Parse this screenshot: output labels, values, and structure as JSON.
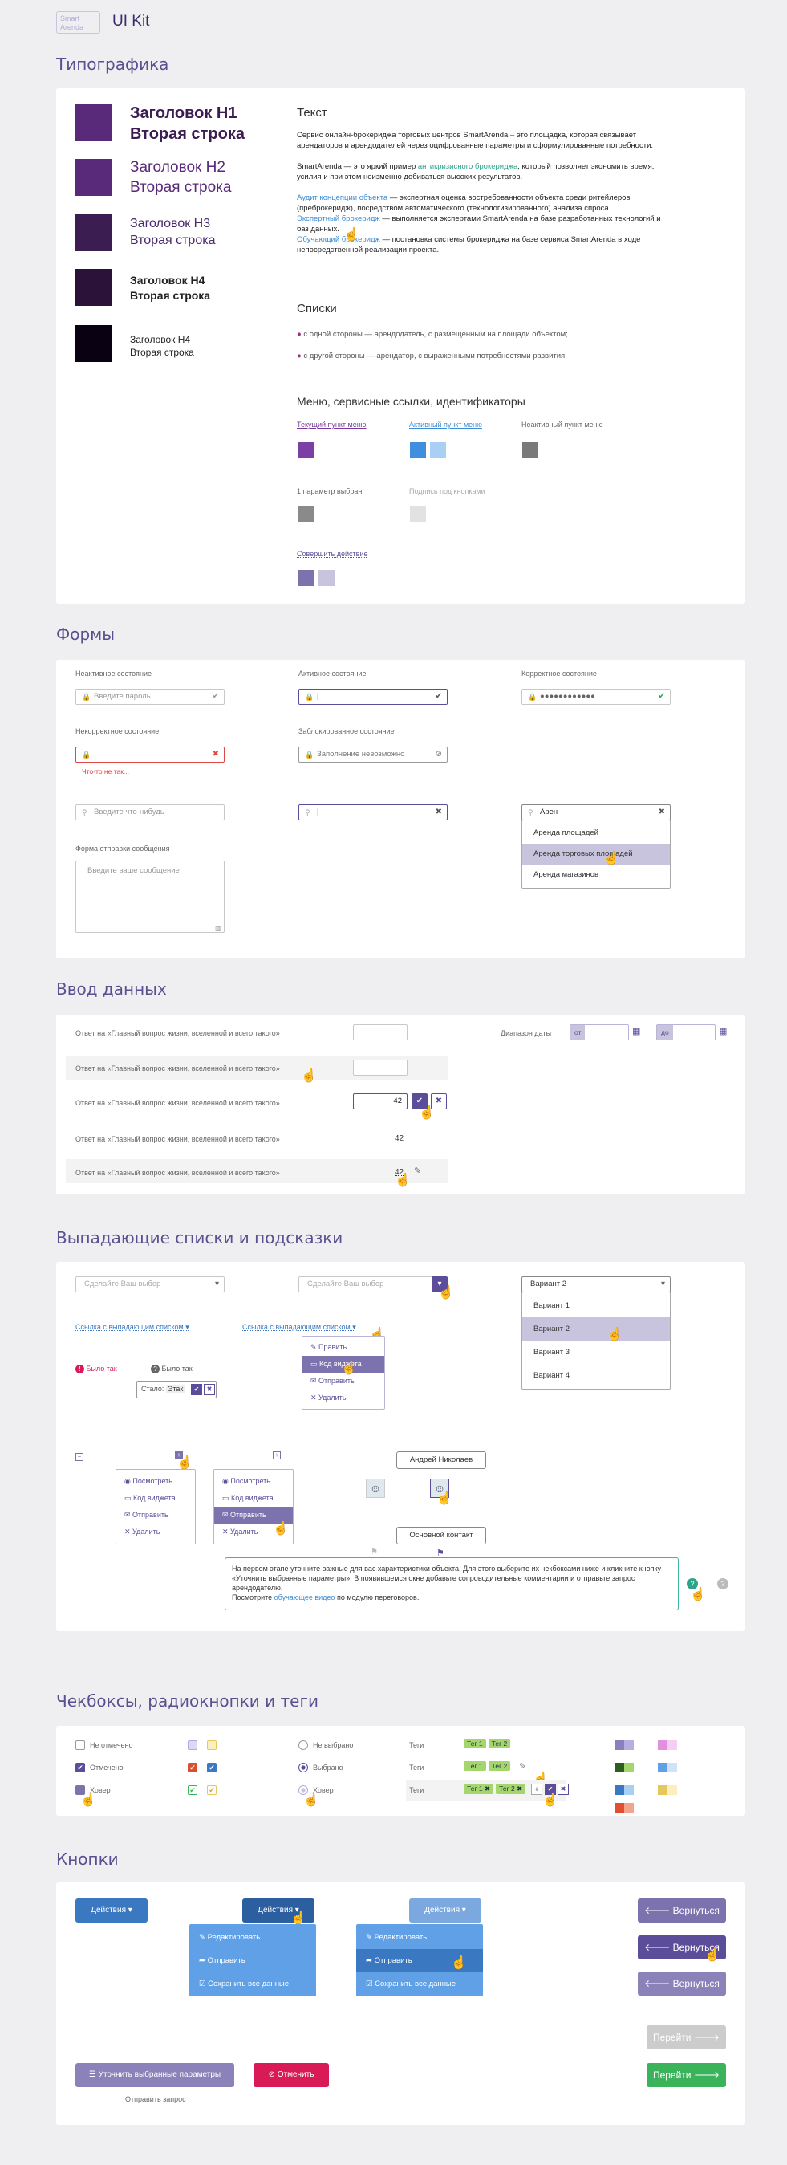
{
  "header": {
    "logo": "Smart Arenda",
    "title": "UI Kit"
  },
  "sections": {
    "typography": "Типографика",
    "forms": "Формы",
    "input": "Ввод данных",
    "dropdowns": "Выпадающие списки и подсказки",
    "checkboxes": "Чекбоксы, радиокнопки и теги",
    "buttons": "Кнопки"
  },
  "typo": {
    "h1": [
      "Заголовок H1",
      "Вторая строка"
    ],
    "h2": [
      "Заголовок H2",
      "Вторая строка"
    ],
    "h3": [
      "Заголовок H3",
      "Вторая строка"
    ],
    "h4b": [
      "Заголовок H4",
      "Вторая строка"
    ],
    "h4": [
      "Заголовок H4",
      "Вторая строка"
    ],
    "text_title": "Текст",
    "p1": "Сервис онлайн-брокериджа торговых центров SmartArenda – это площадка, которая связывает арендаторов и арендодателей через оцифрованные параметры и сформулированные потребности.",
    "p2a": "SmartArenda — это яркий пример ",
    "p2link": "антикризисного брокериджа",
    "p2b": ", который позволяет экономить время, усилия и при этом неизменно добиваться высоких результатов.",
    "p3link": "Аудит концепции объекта",
    "p3": " — экспертная оценка востребованности объекта среди ритейлеров (преброкеридж), посредством автоматического (технологизированного) анализа спроса.",
    "p4link": "Экспертный брокеридж",
    "p4": " — выполняется экспертами SmartArenda на базе разработанных технологий и баз данных.",
    "p5link": "Обучающий брокеридж",
    "p5": " — постановка системы брокериджа на базе сервиса SmartArenda в ходе непосредственной реализации проекта.",
    "lists_title": "Списки",
    "li1": "с одной стороны — арендодатель, с размещенным на площади объектом;",
    "li2": "с другой стороны — арендатор, с выраженными потребностями развития.",
    "menu_title": "Меню, сервисные ссылки, идентификаторы",
    "m_current": "Текущий пункт меню",
    "m_active": "Активный пункт меню",
    "m_inactive": "Неактивный пункт меню",
    "m_param": "1 параметр выбран",
    "m_caption": "Подпись под кнопками",
    "m_action": "Совершить действие"
  },
  "forms": {
    "inactive": "Неактивное состояние",
    "active": "Активное состояние",
    "correct": "Корректное состояние",
    "incorrect": "Некорректное состояние",
    "blocked": "Заблокированное состояние",
    "pwd_ph": "Введите пароль",
    "blocked_ph": "Заполнение невозможно",
    "pwd_dots": "●●●●●●●●●●●●",
    "err": "Что-то не так...",
    "search_ph": "Введите что-нибудь",
    "search_val": "Арен",
    "ac": [
      "Аренда площадей",
      "Аренда торговых площадей",
      "Аренда магазинов"
    ],
    "msg_label": "Форма отправки сообщения",
    "msg_ph": "Введите ваше сообщение"
  },
  "input": {
    "q": "Ответ на «Главный вопрос жизни, вселенной и всего такого»",
    "val": "42",
    "range": "Диапазон даты",
    "from": "от",
    "to": "до"
  },
  "dropdowns": {
    "ph": "Сделайте Ваш выбор",
    "link": "Ссылка с выпадающим списком",
    "variant": "Вариант 2",
    "variants": [
      "Вариант 1",
      "Вариант 2",
      "Вариант 3",
      "Вариант 4"
    ],
    "ctx": [
      "Править",
      "Код виджета",
      "Отправить",
      "Удалить"
    ],
    "was": "Было так",
    "now_label": "Стало:",
    "now_val": "Этак",
    "ctx2": [
      "Посмотреть",
      "Код виджета",
      "Отправить",
      "Удалить"
    ],
    "person": "Андрей Николаев",
    "contact": "Основной контакт",
    "hint1": "На первом этапе уточните важные для вас характеристики объекта. Для этого выберите их чекбоксами ниже и кликните кнопку «Уточнить выбранные параметры». В появившемся окне добавьте сопроводительные комментарии и отправьте запрос арендодателю.",
    "hint2a": "Посмотрите ",
    "hint2link": "обучающее видео",
    "hint2b": " по модулю переговоров."
  },
  "checks": {
    "unchecked": "Не отмечено",
    "checked": "Отмечено",
    "hover": "Ховер",
    "r_not": "Не выбрано",
    "r_sel": "Выбрано",
    "r_hover": "Ховер",
    "tags_lbl": "Теги",
    "t1": "Тег 1",
    "t2": "Тег 2"
  },
  "buttons": {
    "actions": "Действия",
    "edit": "Редактировать",
    "send": "Отправить",
    "save": "Сохранить все данные",
    "back": "Вернуться",
    "next": "Перейти",
    "refine": "Уточнить выбранные параметры",
    "cancel": "Отменить",
    "send_req": "Отправить запрос"
  },
  "colors": {
    "accent": "#5b4d9a",
    "purple": "#7c72ad",
    "blue": "#3a78c2",
    "green": "#3bb35a",
    "red": "#d81b57"
  }
}
